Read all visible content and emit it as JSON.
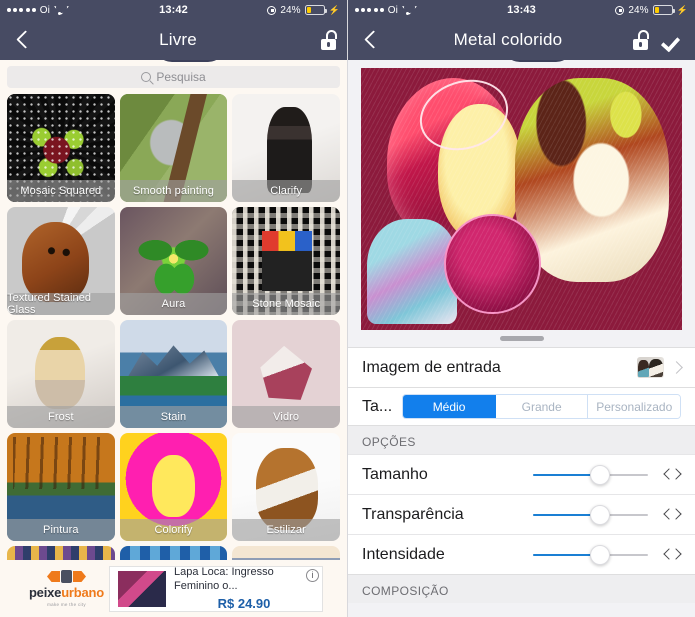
{
  "left": {
    "status": {
      "carrier": "Oi",
      "signal_dots": 5,
      "wifi": "wifi-icon",
      "time": "13:42",
      "battery_pct": "24%",
      "battery_level": 24,
      "charging": true
    },
    "nav": {
      "back": "back-chevron-icon",
      "title": "Livre",
      "lock": "lock-open-icon"
    },
    "search": {
      "placeholder": "Pesquisa",
      "value": "",
      "icon": "search-icon"
    },
    "tiles": [
      {
        "label": "Mosaic Squared",
        "art": "a-mosaic"
      },
      {
        "label": "Smooth painting",
        "art": "a-koala"
      },
      {
        "label": "Clarify",
        "art": "a-clarify"
      },
      {
        "label": "Textured Stained Glass",
        "art": "a-stained"
      },
      {
        "label": "Aura",
        "art": "a-aura"
      },
      {
        "label": "Stone Mosaic",
        "art": "a-stone"
      },
      {
        "label": "Frost",
        "art": "a-frost"
      },
      {
        "label": "Stain",
        "art": "a-stain"
      },
      {
        "label": "Vidro",
        "art": "a-vidro"
      },
      {
        "label": "Pintura",
        "art": "a-pintura"
      },
      {
        "label": "Colorify",
        "art": "a-colorify"
      },
      {
        "label": "Estilizar",
        "art": "a-estilizar"
      }
    ],
    "ad": {
      "brand_a": "peixe",
      "brand_b": "urbano",
      "brand_tagline": "make me the city",
      "title": "Lapa Loca: Ingresso Feminino o...",
      "price": "R$ 24.90",
      "info_icon": "info-icon"
    }
  },
  "right": {
    "status": {
      "carrier": "Oi",
      "signal_dots": 5,
      "wifi": "wifi-icon",
      "time": "13:43",
      "battery_pct": "24%",
      "battery_level": 24,
      "charging": true
    },
    "nav": {
      "back": "back-chevron-icon",
      "title": "Metal colorido",
      "lock": "lock-open-icon",
      "confirm": "check-icon"
    },
    "input_row": {
      "label": "Imagem de entrada",
      "thumb": "input-image-thumbnail",
      "chevron": "chevron-right-icon"
    },
    "size_row": {
      "label": "Ta...",
      "options": [
        "Médio",
        "Grande",
        "Personalizado"
      ],
      "selected": "Médio"
    },
    "sections": [
      {
        "header": "OPÇÕES",
        "sliders": [
          {
            "label": "Tamanho",
            "value": 58
          },
          {
            "label": "Transparência",
            "value": 58
          },
          {
            "label": "Intensidade",
            "value": 58
          }
        ]
      },
      {
        "header": "COMPOSIÇÃO",
        "sliders": []
      }
    ],
    "accent_color": "#127fec"
  }
}
